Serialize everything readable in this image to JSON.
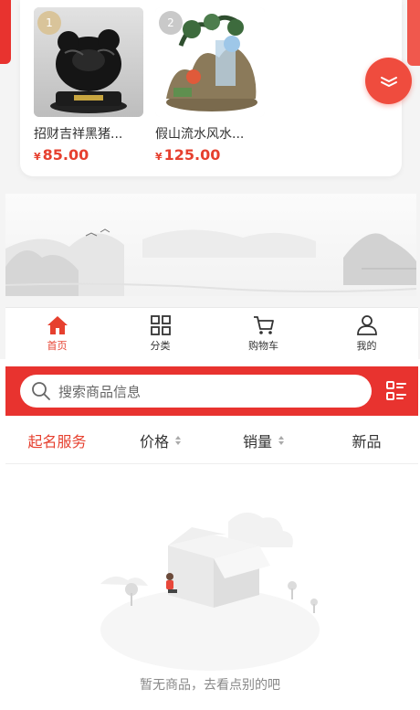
{
  "ranking": {
    "products": [
      {
        "rank": "1",
        "name": "招财吉祥黑猪...",
        "currency": "¥",
        "price": "85.00"
      },
      {
        "rank": "2",
        "name": "假山流水风水...",
        "currency": "¥",
        "price": "125.00"
      }
    ]
  },
  "tabbar": {
    "items": [
      {
        "label": "首页",
        "icon": "home-icon",
        "active": true
      },
      {
        "label": "分类",
        "icon": "grid-icon",
        "active": false
      },
      {
        "label": "购物车",
        "icon": "cart-icon",
        "active": false
      },
      {
        "label": "我的",
        "icon": "user-icon",
        "active": false
      }
    ]
  },
  "search": {
    "placeholder": "搜索商品信息",
    "icon": "search-icon",
    "toggle_icon": "list-view-icon"
  },
  "sort": {
    "items": [
      {
        "label": "起名服务",
        "active": true,
        "sortable": false
      },
      {
        "label": "价格",
        "active": false,
        "sortable": true
      },
      {
        "label": "销量",
        "active": false,
        "sortable": true
      },
      {
        "label": "新品",
        "active": false,
        "sortable": false
      }
    ]
  },
  "empty": {
    "message": "暂无商品，去看点别的吧"
  },
  "colors": {
    "accent": "#e8332f",
    "price": "#e6402f"
  }
}
